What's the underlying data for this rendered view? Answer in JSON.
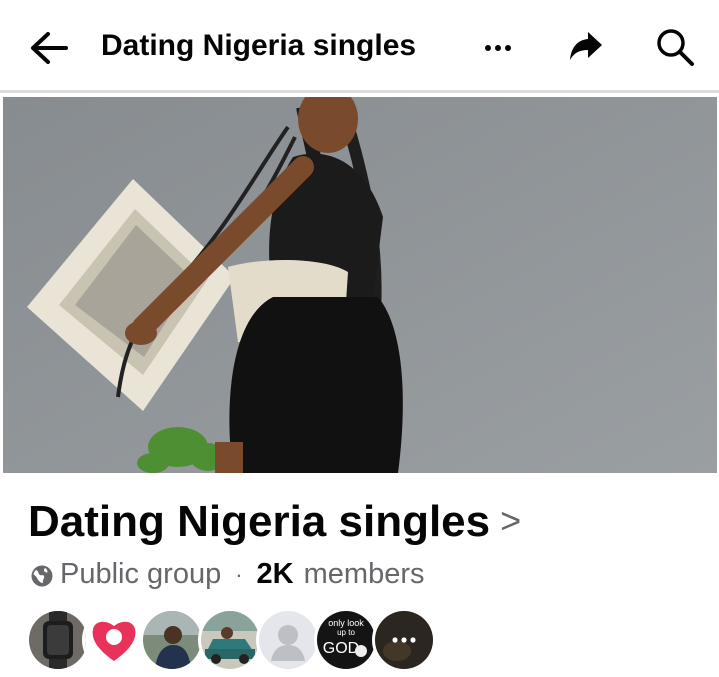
{
  "header": {
    "title": "Dating Nigeria singles",
    "icons": [
      "back-arrow-icon",
      "more-dots-icon",
      "share-icon",
      "search-icon"
    ]
  },
  "group": {
    "name": "Dating Nigeria singles",
    "chevron": ">",
    "privacy": "Public group",
    "separator": "·",
    "member_count": "2K",
    "member_label": "members"
  },
  "member_avatars": [
    {
      "name": "avatar-watch"
    },
    {
      "name": "avatar-pink-logo"
    },
    {
      "name": "avatar-man-outdoors"
    },
    {
      "name": "avatar-car"
    },
    {
      "name": "avatar-placeholder"
    },
    {
      "name": "avatar-god-text",
      "text_lines": [
        "only look",
        "up to",
        "GOD"
      ]
    },
    {
      "name": "avatar-more"
    }
  ],
  "colors": {
    "text_primary": "#050505",
    "text_secondary": "#65676b",
    "divider": "#dcdcdc",
    "avatar_pink": "#e8325a"
  }
}
